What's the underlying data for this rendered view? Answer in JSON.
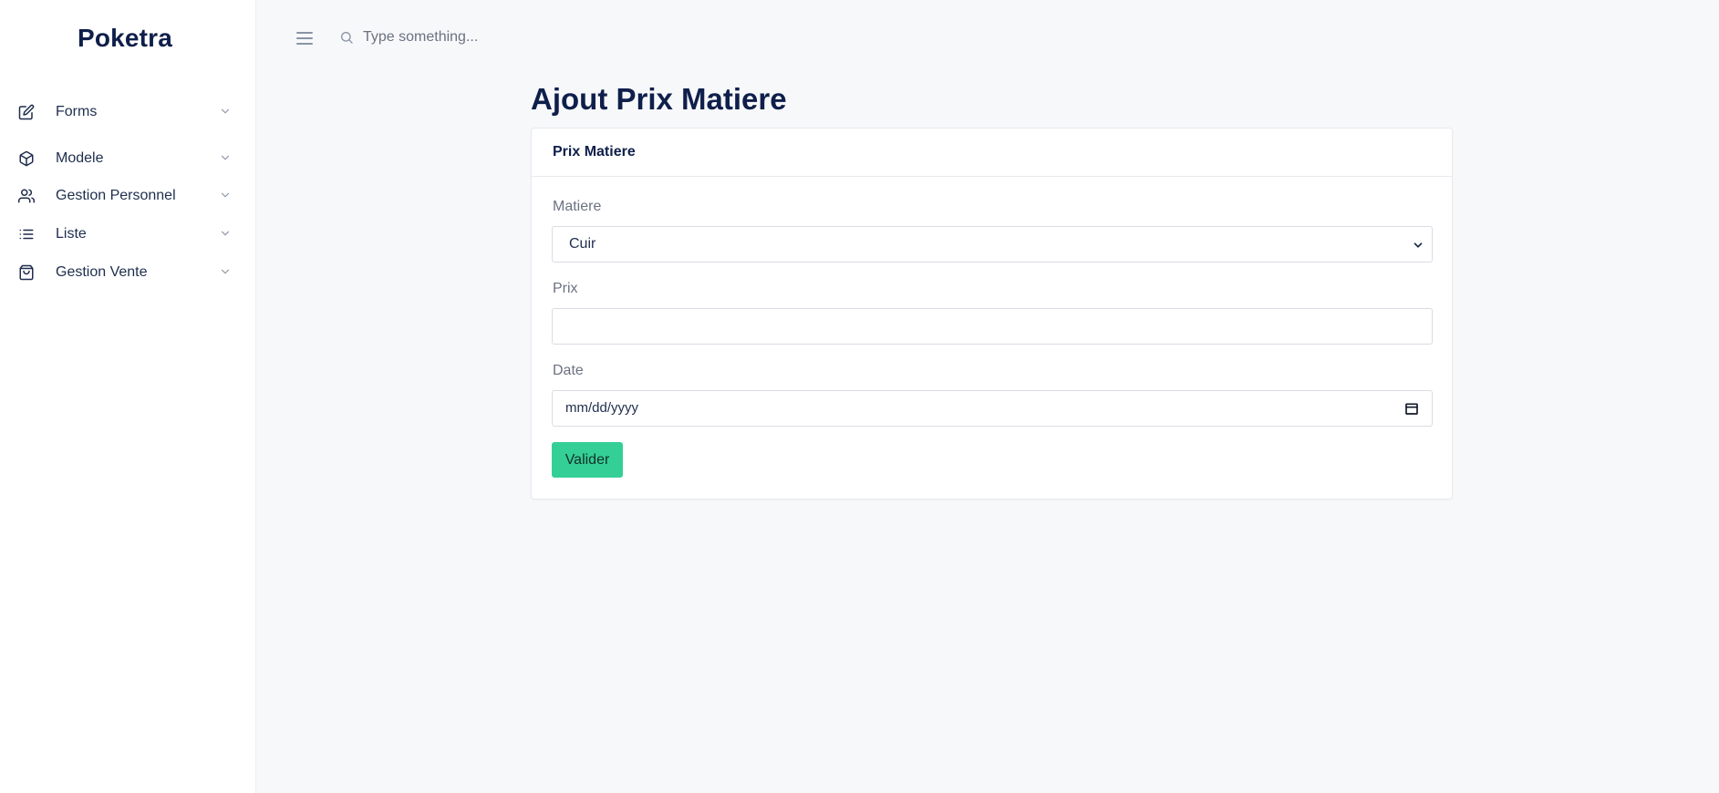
{
  "app": {
    "brand": "Poketra"
  },
  "sidebar": {
    "items": [
      {
        "label": "Forms",
        "icon": "edit-icon"
      },
      {
        "label": "Modele",
        "icon": "box-icon"
      },
      {
        "label": "Gestion Personnel",
        "icon": "users-icon"
      },
      {
        "label": "Liste",
        "icon": "list-icon"
      },
      {
        "label": "Gestion Vente",
        "icon": "shopping-bag-icon"
      }
    ]
  },
  "topbar": {
    "search_placeholder": "Type something..."
  },
  "page": {
    "title": "Ajout Prix Matiere"
  },
  "form": {
    "card_title": "Prix Matiere",
    "matiere": {
      "label": "Matiere",
      "selected": "Cuir"
    },
    "prix": {
      "label": "Prix",
      "value": ""
    },
    "date": {
      "label": "Date",
      "placeholder": "mm/dd/yyyy"
    },
    "submit_label": "Valider"
  },
  "colors": {
    "accent": "#34cf96",
    "brand_text": "#0f1f4b",
    "background": "#f7f8fa"
  }
}
